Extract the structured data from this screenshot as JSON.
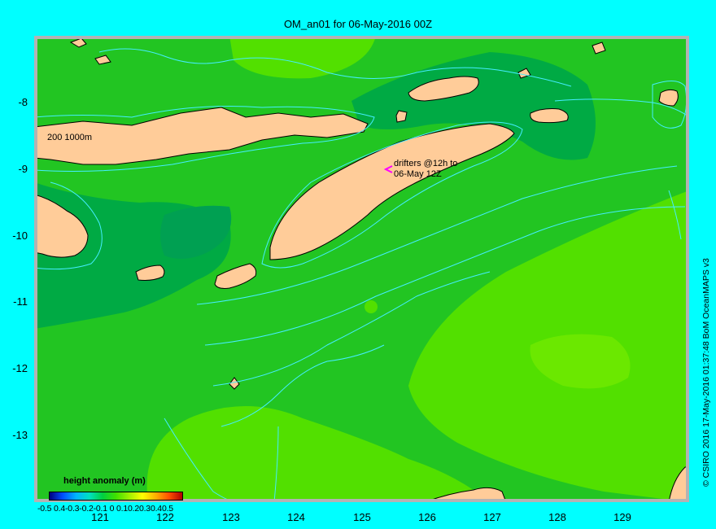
{
  "title": "OM_an01 for 06-May-2016 00Z",
  "y_ticks": [
    "-8",
    "-9",
    "-10",
    "-11",
    "-12",
    "-13"
  ],
  "x_ticks": [
    "121",
    "122",
    "123",
    "124",
    "125",
    "126",
    "127",
    "128",
    "129"
  ],
  "contour_label": "200  1000m",
  "drifters_label_line1": "drifters @12h to",
  "drifters_label_line2": "06-May 12Z",
  "colorbar_title": "height anomaly  (m)",
  "colorbar_labels": "-0.5 0.4-0.3-0.2-0.1  0 0.10.20.30.40.5",
  "colorbar_colors": [
    "#000080",
    "#0050ff",
    "#00b4ff",
    "#00e0c0",
    "#00d040",
    "#40e000",
    "#a0f000",
    "#ffff00",
    "#ffb000",
    "#ff5000",
    "#b00000"
  ],
  "credit": "© CSIRO 2016   17-May-2016 01:37:48 BoM OceanMAPS v3",
  "colors": {
    "ocean_mid": "#22c522",
    "ocean_dark": "#00aa44",
    "ocean_darker": "#00a052",
    "ocean_light": "#52e000",
    "ocean_lighter": "#6be800",
    "land": "#ffcc99",
    "coast": "#b3b3b3",
    "contour": "#44eeff",
    "drifter": "#ff00ff"
  }
}
